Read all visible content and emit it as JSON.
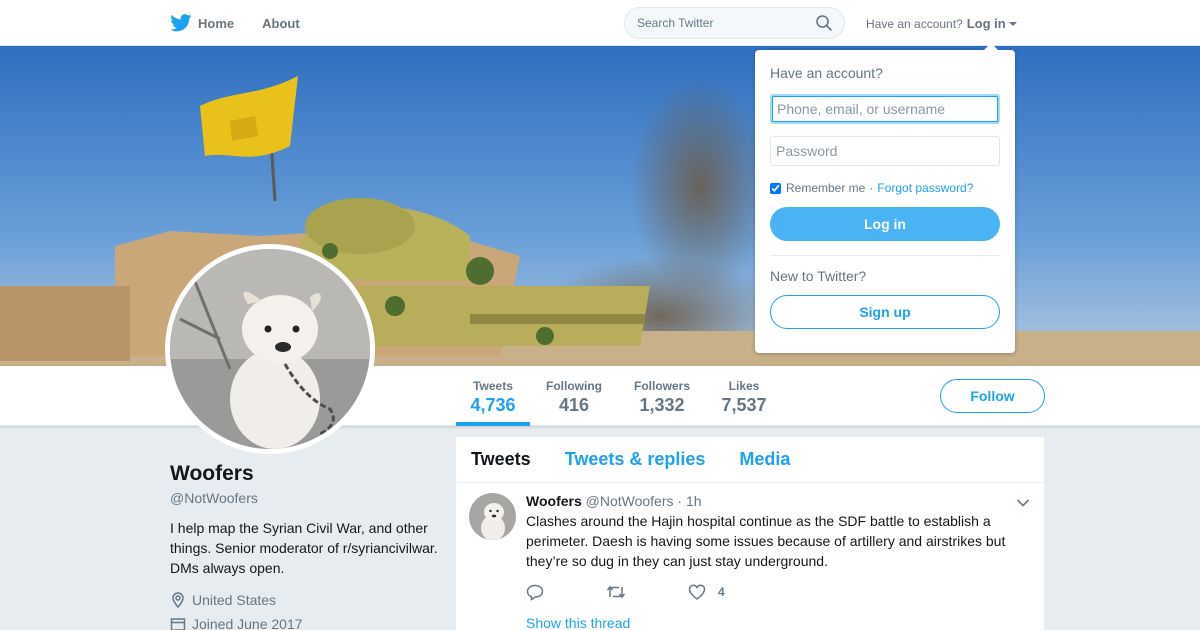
{
  "nav": {
    "home_label": "Home",
    "about_label": "About",
    "search_placeholder": "Search Twitter",
    "have_account": "Have an account?",
    "login_label": "Log in"
  },
  "profile": {
    "name": "Woofers",
    "handle": "@NotWoofers",
    "bio": "I help map the Syrian Civil War, and other things. Senior moderator of r/syriancivilwar. DMs always open.",
    "location": "United States",
    "joined": "Joined June 2017"
  },
  "stats": [
    {
      "label": "Tweets",
      "value": "4,736",
      "active": true
    },
    {
      "label": "Following",
      "value": "416",
      "active": false
    },
    {
      "label": "Followers",
      "value": "1,332",
      "active": false
    },
    {
      "label": "Likes",
      "value": "7,537",
      "active": false
    }
  ],
  "follow_label": "Follow",
  "tabs": [
    {
      "label": "Tweets",
      "active": true
    },
    {
      "label": "Tweets & replies",
      "active": false
    },
    {
      "label": "Media",
      "active": false
    }
  ],
  "tweet": {
    "name": "Woofers",
    "handle": "@NotWoofers",
    "time": "· 1h",
    "text": "Clashes around the Hajin hospital continue as the SDF battle to establish a perimeter. Daesh is having some issues because of artillery and airstrikes but they’re so dug in they can just stay underground.",
    "likes": "4",
    "show_thread": "Show this thread"
  },
  "login_dropdown": {
    "heading": "Have an account?",
    "username_placeholder": "Phone, email, or username",
    "password_placeholder": "Password",
    "remember_label": "Remember me",
    "separator": "·",
    "forgot_label": "Forgot password?",
    "login_button": "Log in",
    "new_label": "New to Twitter?",
    "signup_button": "Sign up"
  },
  "colors": {
    "accent": "#1da1f2",
    "background": "#e6ecf0",
    "text_muted": "#657786"
  },
  "icons": [
    "twitter-bird-icon",
    "search-icon",
    "location-pin-icon",
    "calendar-icon",
    "reply-icon",
    "retweet-icon",
    "heart-icon",
    "chevron-down-icon"
  ]
}
